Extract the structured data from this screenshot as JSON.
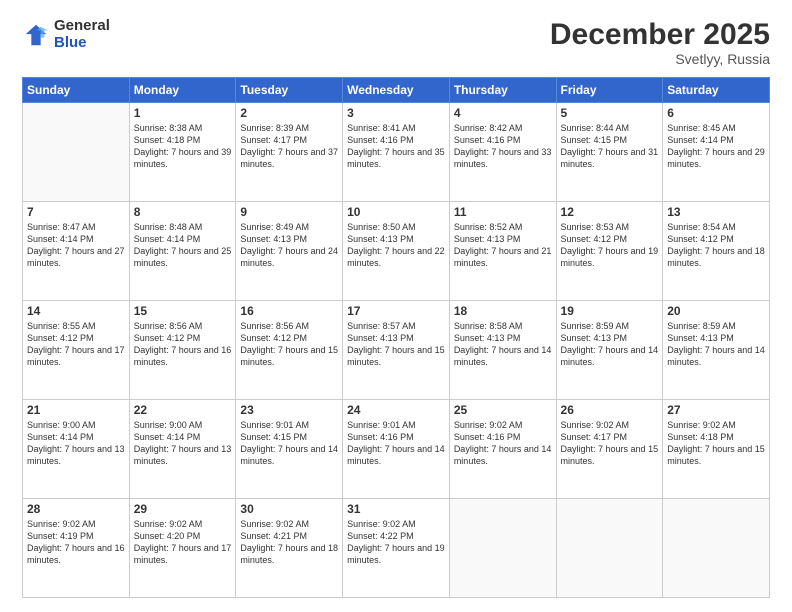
{
  "logo": {
    "general": "General",
    "blue": "Blue"
  },
  "header": {
    "month": "December 2025",
    "location": "Svetlyy, Russia"
  },
  "days_of_week": [
    "Sunday",
    "Monday",
    "Tuesday",
    "Wednesday",
    "Thursday",
    "Friday",
    "Saturday"
  ],
  "weeks": [
    [
      {
        "day": "",
        "sunrise": "",
        "sunset": "",
        "daylight": ""
      },
      {
        "day": "1",
        "sunrise": "Sunrise: 8:38 AM",
        "sunset": "Sunset: 4:18 PM",
        "daylight": "Daylight: 7 hours and 39 minutes."
      },
      {
        "day": "2",
        "sunrise": "Sunrise: 8:39 AM",
        "sunset": "Sunset: 4:17 PM",
        "daylight": "Daylight: 7 hours and 37 minutes."
      },
      {
        "day": "3",
        "sunrise": "Sunrise: 8:41 AM",
        "sunset": "Sunset: 4:16 PM",
        "daylight": "Daylight: 7 hours and 35 minutes."
      },
      {
        "day": "4",
        "sunrise": "Sunrise: 8:42 AM",
        "sunset": "Sunset: 4:16 PM",
        "daylight": "Daylight: 7 hours and 33 minutes."
      },
      {
        "day": "5",
        "sunrise": "Sunrise: 8:44 AM",
        "sunset": "Sunset: 4:15 PM",
        "daylight": "Daylight: 7 hours and 31 minutes."
      },
      {
        "day": "6",
        "sunrise": "Sunrise: 8:45 AM",
        "sunset": "Sunset: 4:14 PM",
        "daylight": "Daylight: 7 hours and 29 minutes."
      }
    ],
    [
      {
        "day": "7",
        "sunrise": "Sunrise: 8:47 AM",
        "sunset": "Sunset: 4:14 PM",
        "daylight": "Daylight: 7 hours and 27 minutes."
      },
      {
        "day": "8",
        "sunrise": "Sunrise: 8:48 AM",
        "sunset": "Sunset: 4:14 PM",
        "daylight": "Daylight: 7 hours and 25 minutes."
      },
      {
        "day": "9",
        "sunrise": "Sunrise: 8:49 AM",
        "sunset": "Sunset: 4:13 PM",
        "daylight": "Daylight: 7 hours and 24 minutes."
      },
      {
        "day": "10",
        "sunrise": "Sunrise: 8:50 AM",
        "sunset": "Sunset: 4:13 PM",
        "daylight": "Daylight: 7 hours and 22 minutes."
      },
      {
        "day": "11",
        "sunrise": "Sunrise: 8:52 AM",
        "sunset": "Sunset: 4:13 PM",
        "daylight": "Daylight: 7 hours and 21 minutes."
      },
      {
        "day": "12",
        "sunrise": "Sunrise: 8:53 AM",
        "sunset": "Sunset: 4:12 PM",
        "daylight": "Daylight: 7 hours and 19 minutes."
      },
      {
        "day": "13",
        "sunrise": "Sunrise: 8:54 AM",
        "sunset": "Sunset: 4:12 PM",
        "daylight": "Daylight: 7 hours and 18 minutes."
      }
    ],
    [
      {
        "day": "14",
        "sunrise": "Sunrise: 8:55 AM",
        "sunset": "Sunset: 4:12 PM",
        "daylight": "Daylight: 7 hours and 17 minutes."
      },
      {
        "day": "15",
        "sunrise": "Sunrise: 8:56 AM",
        "sunset": "Sunset: 4:12 PM",
        "daylight": "Daylight: 7 hours and 16 minutes."
      },
      {
        "day": "16",
        "sunrise": "Sunrise: 8:56 AM",
        "sunset": "Sunset: 4:12 PM",
        "daylight": "Daylight: 7 hours and 15 minutes."
      },
      {
        "day": "17",
        "sunrise": "Sunrise: 8:57 AM",
        "sunset": "Sunset: 4:13 PM",
        "daylight": "Daylight: 7 hours and 15 minutes."
      },
      {
        "day": "18",
        "sunrise": "Sunrise: 8:58 AM",
        "sunset": "Sunset: 4:13 PM",
        "daylight": "Daylight: 7 hours and 14 minutes."
      },
      {
        "day": "19",
        "sunrise": "Sunrise: 8:59 AM",
        "sunset": "Sunset: 4:13 PM",
        "daylight": "Daylight: 7 hours and 14 minutes."
      },
      {
        "day": "20",
        "sunrise": "Sunrise: 8:59 AM",
        "sunset": "Sunset: 4:13 PM",
        "daylight": "Daylight: 7 hours and 14 minutes."
      }
    ],
    [
      {
        "day": "21",
        "sunrise": "Sunrise: 9:00 AM",
        "sunset": "Sunset: 4:14 PM",
        "daylight": "Daylight: 7 hours and 13 minutes."
      },
      {
        "day": "22",
        "sunrise": "Sunrise: 9:00 AM",
        "sunset": "Sunset: 4:14 PM",
        "daylight": "Daylight: 7 hours and 13 minutes."
      },
      {
        "day": "23",
        "sunrise": "Sunrise: 9:01 AM",
        "sunset": "Sunset: 4:15 PM",
        "daylight": "Daylight: 7 hours and 14 minutes."
      },
      {
        "day": "24",
        "sunrise": "Sunrise: 9:01 AM",
        "sunset": "Sunset: 4:16 PM",
        "daylight": "Daylight: 7 hours and 14 minutes."
      },
      {
        "day": "25",
        "sunrise": "Sunrise: 9:02 AM",
        "sunset": "Sunset: 4:16 PM",
        "daylight": "Daylight: 7 hours and 14 minutes."
      },
      {
        "day": "26",
        "sunrise": "Sunrise: 9:02 AM",
        "sunset": "Sunset: 4:17 PM",
        "daylight": "Daylight: 7 hours and 15 minutes."
      },
      {
        "day": "27",
        "sunrise": "Sunrise: 9:02 AM",
        "sunset": "Sunset: 4:18 PM",
        "daylight": "Daylight: 7 hours and 15 minutes."
      }
    ],
    [
      {
        "day": "28",
        "sunrise": "Sunrise: 9:02 AM",
        "sunset": "Sunset: 4:19 PM",
        "daylight": "Daylight: 7 hours and 16 minutes."
      },
      {
        "day": "29",
        "sunrise": "Sunrise: 9:02 AM",
        "sunset": "Sunset: 4:20 PM",
        "daylight": "Daylight: 7 hours and 17 minutes."
      },
      {
        "day": "30",
        "sunrise": "Sunrise: 9:02 AM",
        "sunset": "Sunset: 4:21 PM",
        "daylight": "Daylight: 7 hours and 18 minutes."
      },
      {
        "day": "31",
        "sunrise": "Sunrise: 9:02 AM",
        "sunset": "Sunset: 4:22 PM",
        "daylight": "Daylight: 7 hours and 19 minutes."
      },
      {
        "day": "",
        "sunrise": "",
        "sunset": "",
        "daylight": ""
      },
      {
        "day": "",
        "sunrise": "",
        "sunset": "",
        "daylight": ""
      },
      {
        "day": "",
        "sunrise": "",
        "sunset": "",
        "daylight": ""
      }
    ]
  ]
}
